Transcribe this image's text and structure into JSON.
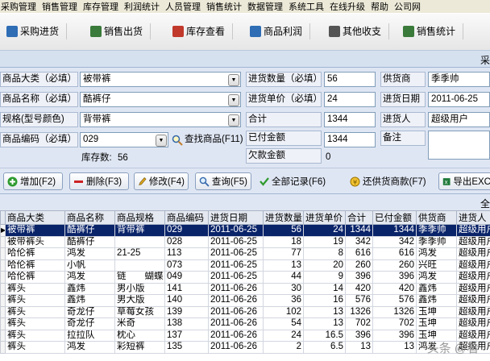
{
  "menubar": {
    "items": [
      "采购管理",
      "销售管理",
      "库存管理",
      "利润统计",
      "人员管理",
      "销售统计",
      "数据管理",
      "系统工具",
      "在线升级",
      "帮助",
      "公司网"
    ]
  },
  "toolbar": {
    "buttons": [
      {
        "label": "采购进货",
        "icon": "purchase-icon",
        "color": "#2f6db5"
      },
      {
        "label": "销售出货",
        "icon": "sales-icon",
        "color": "#3a7a3a"
      },
      {
        "label": "库存查看",
        "icon": "inventory-icon",
        "color": "#c0392b"
      },
      {
        "label": "商品利润",
        "icon": "profit-icon",
        "color": "#2f6db5"
      },
      {
        "label": "其他收支",
        "icon": "income-expense-icon",
        "color": "#555555"
      },
      {
        "label": "销售统计",
        "icon": "statistics-icon",
        "color": "#3a7a3a"
      }
    ]
  },
  "strip": {
    "text": "采"
  },
  "form": {
    "category_label": "商品大类（必填）",
    "category_value": "被带裤",
    "name_label": "商品名称（必填）",
    "name_value": "酷裤仔",
    "spec_label": "规格(型号颜色)",
    "spec_value": "背带裤",
    "code_label": "商品编码（必填）",
    "code_value": "029",
    "find_label": "查找商品(F11)",
    "stock_label": "库存数:",
    "stock_value": "56",
    "qty_label": "进货数量（必填）",
    "qty_value": "56",
    "price_label": "进货单价（必填）",
    "price_value": "24",
    "total_label": "合计",
    "total_value": "1344",
    "paid_label": "已付金额",
    "paid_value": "1344",
    "owed_label": "欠款金额",
    "owed_value": "0",
    "supplier_label": "供货商",
    "supplier_value": "季季帅",
    "date_label": "进货日期",
    "date_value": "2011-06-25",
    "buyer_label": "进货人",
    "buyer_value": "超级用户",
    "remark_label": "备注",
    "remark_value": ""
  },
  "actions": {
    "add": "增加(F2)",
    "delete": "删除(F3)",
    "edit": "修改(F4)",
    "query": "查询(F5)",
    "all_records": "全部记录(F6)",
    "repay": "还供货商款(F7)",
    "export": "导出EXC"
  },
  "gridstrip": {
    "text": "全"
  },
  "grid": {
    "headers": [
      "商品大类",
      "商品名称",
      "商品规格",
      "商品编码",
      "进货日期",
      "进货数量",
      "进货单价",
      "合计",
      "已付金额",
      "供货商",
      "进货人"
    ],
    "rows": [
      [
        "被带裤",
        "酷裤仔",
        "背带裤",
        "029",
        "2011-06-25",
        "56",
        "24",
        "1344",
        "1344",
        "季季帅",
        "超级用户"
      ],
      [
        "被带裤头",
        "酷裤仔",
        "",
        "028",
        "2011-06-25",
        "18",
        "19",
        "342",
        "342",
        "季季帅",
        "超级用户"
      ],
      [
        "哈伦裤",
        "鸿发",
        "21-25",
        "113",
        "2011-06-25",
        "77",
        "8",
        "616",
        "616",
        "鸿发",
        "超级用户"
      ],
      [
        "哈伦裤",
        "小帆",
        "",
        "073",
        "2011-06-25",
        "13",
        "20",
        "260",
        "260",
        "兴旺",
        "超级用户"
      ],
      [
        "哈伦裤",
        "鸿发",
        "链　　蝴蝶",
        "049",
        "2011-06-25",
        "44",
        "9",
        "396",
        "396",
        "鸿发",
        "超级用户"
      ],
      [
        "裤头",
        "鑫炜",
        "男小版",
        "141",
        "2011-06-26",
        "30",
        "14",
        "420",
        "420",
        "鑫炜",
        "超级用户"
      ],
      [
        "裤头",
        "鑫炜",
        "男大版",
        "140",
        "2011-06-26",
        "36",
        "16",
        "576",
        "576",
        "鑫炜",
        "超级用户"
      ],
      [
        "裤头",
        "奇龙仔",
        "草莓女孩",
        "139",
        "2011-06-26",
        "102",
        "13",
        "1326",
        "1326",
        "玉坤",
        "超级用户"
      ],
      [
        "裤头",
        "奇龙仔",
        "米奇",
        "138",
        "2011-06-26",
        "54",
        "13",
        "702",
        "702",
        "玉坤",
        "超级用户"
      ],
      [
        "裤头",
        "拉拉队",
        "枕心",
        "137",
        "2011-06-26",
        "24",
        "16.5",
        "396",
        "396",
        "玉坤",
        "超级用户"
      ],
      [
        "裤头",
        "鸿发",
        "彩短裤",
        "135",
        "2011-06-26",
        "2",
        "6.5",
        "13",
        "13",
        "鸿发",
        "超级用户"
      ]
    ]
  },
  "watermark": "头条 @看"
}
